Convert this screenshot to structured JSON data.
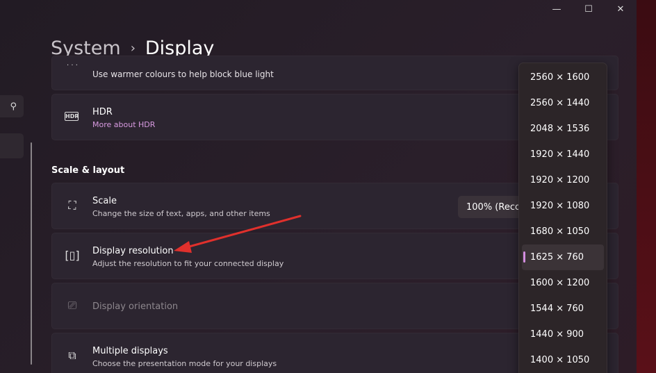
{
  "window": {
    "minimize_icon": "minimize-icon",
    "maximize_icon": "maximize-icon",
    "close_icon": "close-icon"
  },
  "breadcrumb": {
    "parent": "System",
    "separator": "›",
    "current": "Display"
  },
  "night_light": {
    "subtitle": "Use warmer colours to help block blue light"
  },
  "hdr": {
    "title": "HDR",
    "link": "More about HDR",
    "icon": "HDR"
  },
  "section": "Scale & layout",
  "scale": {
    "title": "Scale",
    "subtitle": "Change the size of text, apps, and other items",
    "value": "100% (Recommended)"
  },
  "resolution": {
    "title": "Display resolution",
    "subtitle": "Adjust the resolution to fit your connected display"
  },
  "orientation": {
    "title": "Display orientation"
  },
  "multiple": {
    "title": "Multiple displays",
    "subtitle": "Choose the presentation mode for your displays"
  },
  "resolution_options": [
    "2560 × 1600",
    "2560 × 1440",
    "2048 × 1536",
    "1920 × 1440",
    "1920 × 1200",
    "1920 × 1080",
    "1680 × 1050",
    "1625 × 760",
    "1600 × 1200",
    "1544 × 760",
    "1440 × 900",
    "1400 × 1050"
  ],
  "selected_index": 7,
  "colors": {
    "accent": "#d38ee0",
    "arrow": "#e0302c"
  }
}
